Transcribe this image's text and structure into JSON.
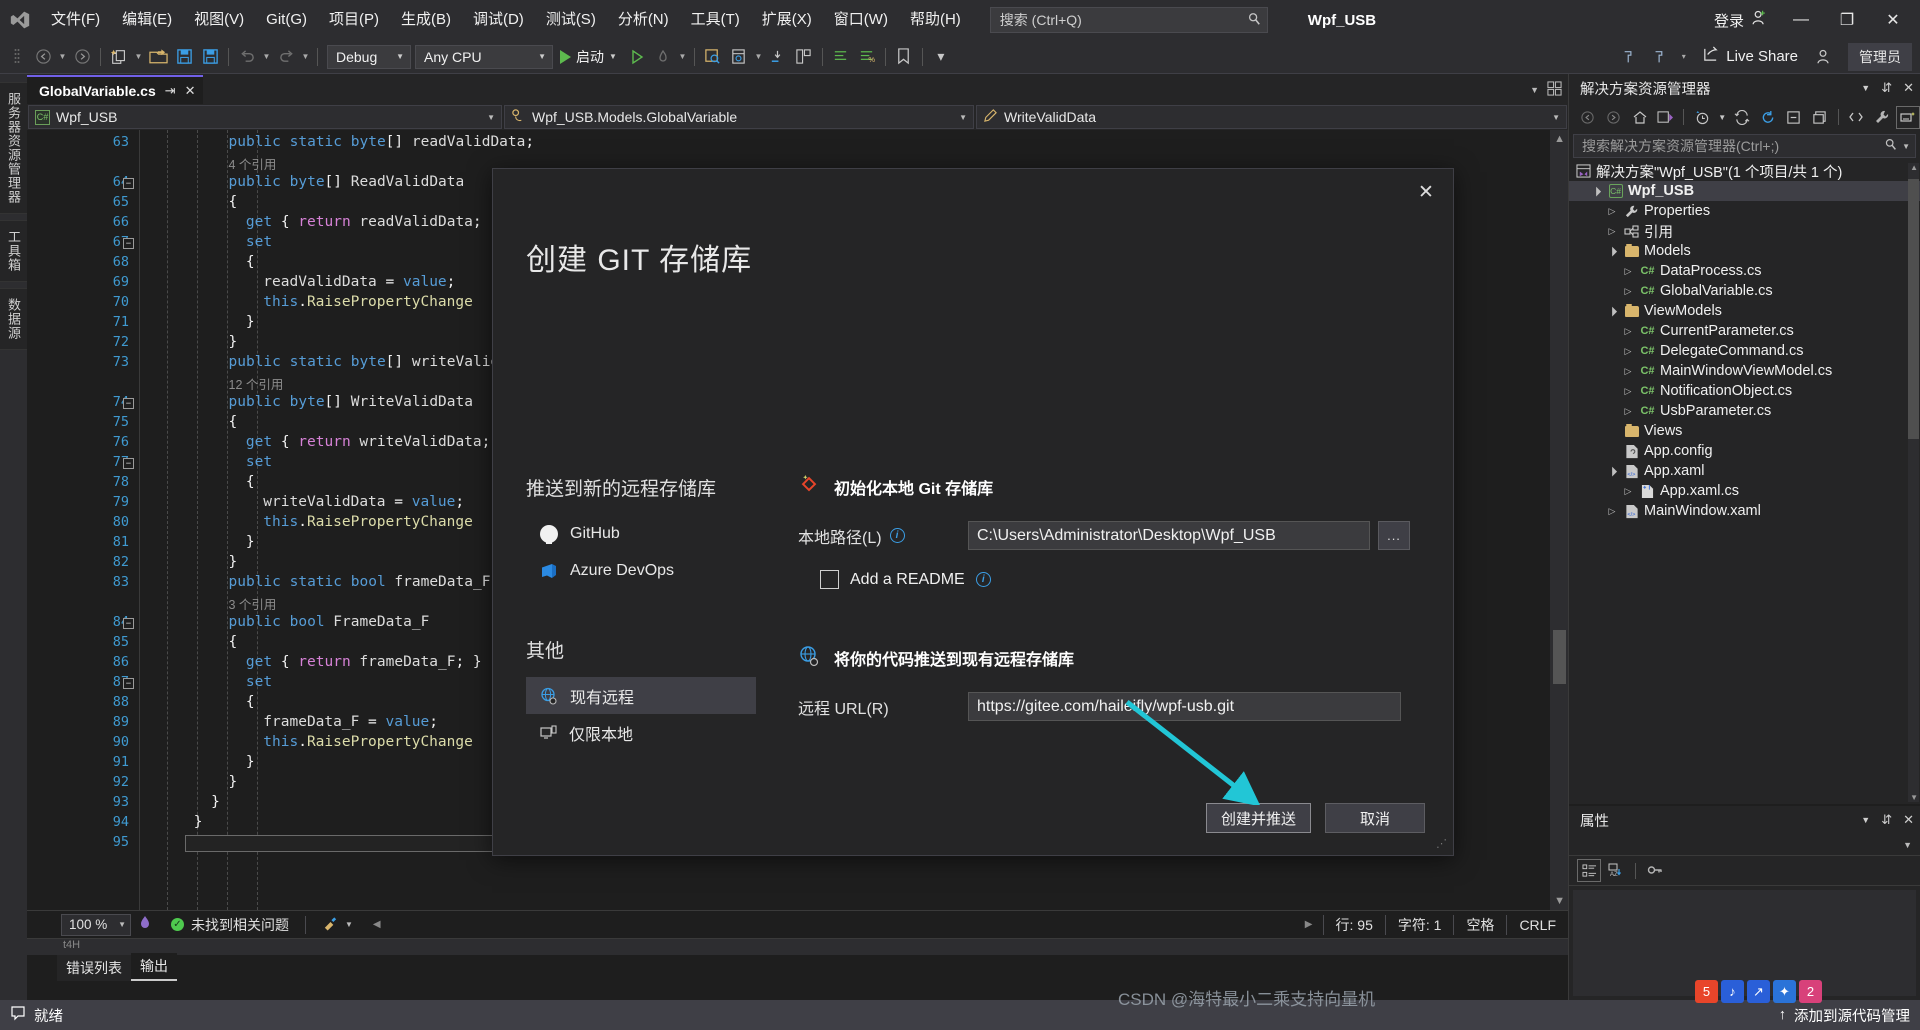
{
  "titlebar": {
    "menus": [
      "文件(F)",
      "编辑(E)",
      "视图(V)",
      "Git(G)",
      "项目(P)",
      "生成(B)",
      "调试(D)",
      "测试(S)",
      "分析(N)",
      "工具(T)",
      "扩展(X)",
      "窗口(W)",
      "帮助(H)"
    ],
    "search_placeholder": "搜索 (Ctrl+Q)",
    "project_title": "Wpf_USB",
    "signin_label": "登录",
    "minimize": "—",
    "restore": "❐",
    "close": "✕"
  },
  "toolbar": {
    "config": "Debug",
    "platform": "Any CPU",
    "run_label": "启动",
    "live_share": "Live Share",
    "admin_badge": "管理员"
  },
  "left_rail": {
    "tabs": [
      "服务器资源管理器",
      "工具箱",
      "数据源"
    ]
  },
  "editor": {
    "tab_name": "GlobalVariable.cs",
    "nav_project": "Wpf_USB",
    "nav_type": "Wpf_USB.Models.GlobalVariable",
    "nav_member": "WriteValidData",
    "lines": [
      {
        "n": "63",
        "code": "public static byte[] readValidData;",
        "indent": 5
      },
      {
        "n": "",
        "code": "4 个引用",
        "ref": true,
        "indent": 5
      },
      {
        "n": "64",
        "code": "public byte[] ReadValidData",
        "indent": 5,
        "fold": true
      },
      {
        "n": "65",
        "code": "{",
        "indent": 5
      },
      {
        "n": "66",
        "code": "get { return readValidData;",
        "indent": 7
      },
      {
        "n": "67",
        "code": "set",
        "indent": 7,
        "fold": true
      },
      {
        "n": "68",
        "code": "{",
        "indent": 7
      },
      {
        "n": "69",
        "code": "readValidData = value;",
        "indent": 9
      },
      {
        "n": "70",
        "code": "this.RaisePropertyChange",
        "indent": 9
      },
      {
        "n": "71",
        "code": "}",
        "indent": 7
      },
      {
        "n": "72",
        "code": "}",
        "indent": 5
      },
      {
        "n": "73",
        "code": "public static byte[] writeValidD",
        "indent": 5
      },
      {
        "n": "",
        "code": "12 个引用",
        "ref": true,
        "indent": 5
      },
      {
        "n": "74",
        "code": "public byte[] WriteValidData",
        "indent": 5,
        "fold": true
      },
      {
        "n": "75",
        "code": "{",
        "indent": 5
      },
      {
        "n": "76",
        "code": "get { return writeValidData;",
        "indent": 7
      },
      {
        "n": "77",
        "code": "set",
        "indent": 7,
        "fold": true
      },
      {
        "n": "78",
        "code": "{",
        "indent": 7
      },
      {
        "n": "79",
        "code": "writeValidData = value;",
        "indent": 9
      },
      {
        "n": "80",
        "code": "this.RaisePropertyChange",
        "indent": 9
      },
      {
        "n": "81",
        "code": "}",
        "indent": 7
      },
      {
        "n": "82",
        "code": "}",
        "indent": 5
      },
      {
        "n": "83",
        "code": "public static bool frameData_F =",
        "indent": 5
      },
      {
        "n": "",
        "code": "3 个引用",
        "ref": true,
        "indent": 5
      },
      {
        "n": "84",
        "code": "public bool FrameData_F",
        "indent": 5,
        "fold": true
      },
      {
        "n": "85",
        "code": "{",
        "indent": 5
      },
      {
        "n": "86",
        "code": "get { return frameData_F; }",
        "indent": 7
      },
      {
        "n": "87",
        "code": "set",
        "indent": 7,
        "fold": true
      },
      {
        "n": "88",
        "code": "{",
        "indent": 7
      },
      {
        "n": "89",
        "code": "frameData_F = value;",
        "indent": 9
      },
      {
        "n": "90",
        "code": "this.RaisePropertyChange",
        "indent": 9
      },
      {
        "n": "91",
        "code": "}",
        "indent": 7
      },
      {
        "n": "92",
        "code": "}",
        "indent": 5
      },
      {
        "n": "93",
        "code": "}",
        "indent": 3
      },
      {
        "n": "94",
        "code": "}",
        "indent": 1
      },
      {
        "n": "95",
        "code": "",
        "indent": 1
      }
    ],
    "status": {
      "zoom": "100 %",
      "issues": "未找到相关问题",
      "line": "行: 95",
      "col": "字符: 1",
      "spacing": "空格",
      "eol": "CRLF"
    },
    "output_tabs": [
      "错误列表",
      "输出"
    ],
    "output_active": "输出",
    "output_header": "t4H"
  },
  "solution_explorer": {
    "title": "解决方案资源管理器",
    "search_placeholder": "搜索解决方案资源管理器(Ctrl+;)",
    "root": "解决方案\"Wpf_USB\"(1 个项目/共 1 个)",
    "items": [
      {
        "label": "Wpf_USB",
        "depth": 1,
        "icon": "cs-project",
        "arrow": "open",
        "selected": true,
        "bold": true
      },
      {
        "label": "Properties",
        "depth": 2,
        "icon": "wrench",
        "arrow": "closed"
      },
      {
        "label": "引用",
        "depth": 2,
        "icon": "refs",
        "arrow": "closed"
      },
      {
        "label": "Models",
        "depth": 2,
        "icon": "folder",
        "arrow": "open"
      },
      {
        "label": "DataProcess.cs",
        "depth": 3,
        "icon": "cs",
        "arrow": "closed"
      },
      {
        "label": "GlobalVariable.cs",
        "depth": 3,
        "icon": "cs",
        "arrow": "closed"
      },
      {
        "label": "ViewModels",
        "depth": 2,
        "icon": "folder",
        "arrow": "open"
      },
      {
        "label": "CurrentParameter.cs",
        "depth": 3,
        "icon": "cs",
        "arrow": "closed"
      },
      {
        "label": "DelegateCommand.cs",
        "depth": 3,
        "icon": "cs",
        "arrow": "closed"
      },
      {
        "label": "MainWindowViewModel.cs",
        "depth": 3,
        "icon": "cs",
        "arrow": "closed"
      },
      {
        "label": "NotificationObject.cs",
        "depth": 3,
        "icon": "cs",
        "arrow": "closed"
      },
      {
        "label": "UsbParameter.cs",
        "depth": 3,
        "icon": "cs",
        "arrow": "closed"
      },
      {
        "label": "Views",
        "depth": 2,
        "icon": "folder",
        "arrow": "none"
      },
      {
        "label": "App.config",
        "depth": 2,
        "icon": "config",
        "arrow": "none"
      },
      {
        "label": "App.xaml",
        "depth": 2,
        "icon": "xaml",
        "arrow": "open"
      },
      {
        "label": "App.xaml.cs",
        "depth": 3,
        "icon": "file",
        "arrow": "closed"
      },
      {
        "label": "MainWindow.xaml",
        "depth": 2,
        "icon": "xaml",
        "arrow": "closed"
      }
    ]
  },
  "properties_panel": {
    "title": "属性"
  },
  "dialog": {
    "title": "创建 GIT 存储库",
    "close_label": "✕",
    "left": {
      "section1_title": "推送到新的远程存储库",
      "providers": [
        {
          "label": "GitHub",
          "icon": "github-icon",
          "active": false
        },
        {
          "label": "Azure DevOps",
          "icon": "azure-devops-icon",
          "active": false
        }
      ],
      "section2_title": "其他",
      "others": [
        {
          "label": "现有远程",
          "icon": "globe-icon",
          "active": true
        },
        {
          "label": "仅限本地",
          "icon": "monitor-icon",
          "active": false
        }
      ]
    },
    "group_local": {
      "title": "初始化本地 Git 存储库",
      "path_label": "本地路径(L)",
      "path_value": "C:\\Users\\Administrator\\Desktop\\Wpf_USB",
      "browse_label": "...",
      "readme_label": "Add a README",
      "readme_checked": false
    },
    "group_remote": {
      "title": "将你的代码推送到现有远程存储库",
      "url_label": "远程 URL(R)",
      "url_value": "https://gitee.com/haileifly/wpf-usb.git"
    },
    "buttons": {
      "primary": "创建并推送",
      "cancel": "取消"
    }
  },
  "statusbar": {
    "ready": "就绪",
    "source_control": "添加到源代码管理",
    "arrow_up": "↑"
  },
  "watermark": {
    "text": "CSDN @海特最小二乘支持向量机"
  },
  "colors": {
    "accent": "#7160e8",
    "tab_accent": "#3f3f46",
    "arrow_annotation": "#22c6d6",
    "link_blue": "#3b9ee5",
    "status_bar": "#3f3f46"
  }
}
